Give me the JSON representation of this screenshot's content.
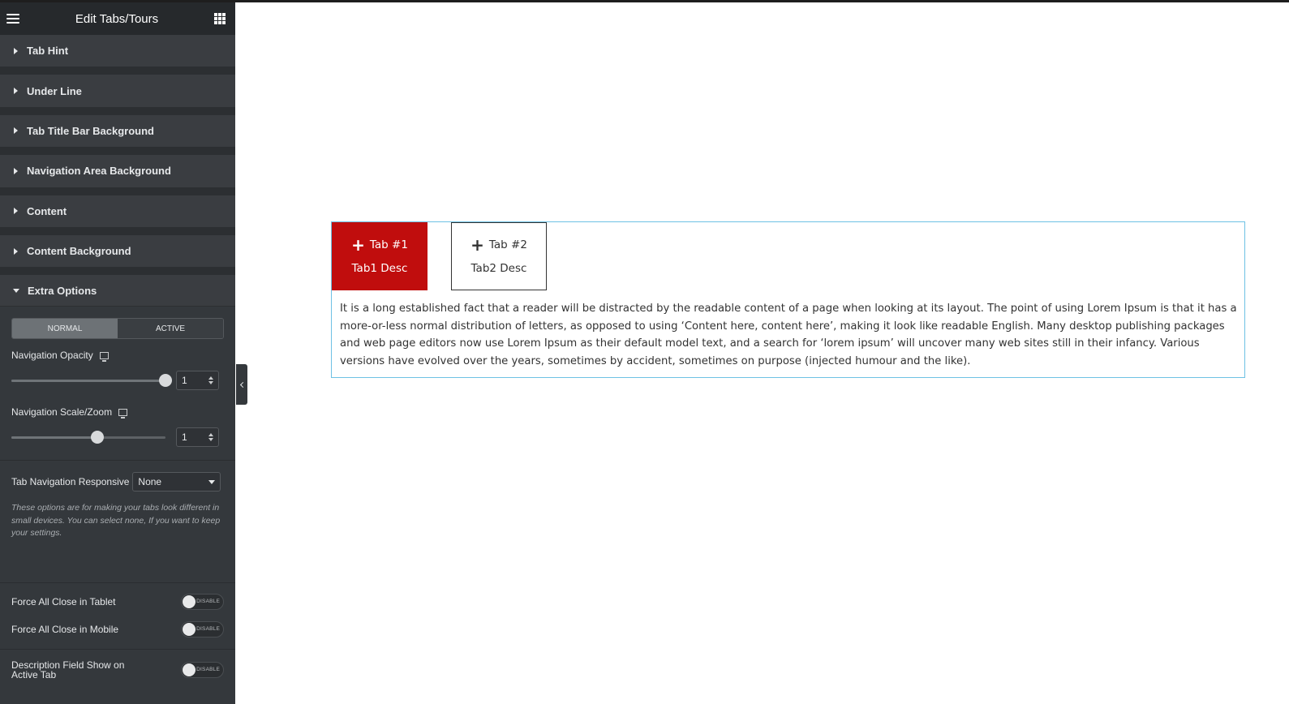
{
  "panel": {
    "title": "Edit Tabs/Tours",
    "sections": [
      {
        "label": "Tab Hint"
      },
      {
        "label": "Under Line"
      },
      {
        "label": "Tab Title Bar Background"
      },
      {
        "label": "Navigation Area Background"
      },
      {
        "label": "Content"
      },
      {
        "label": "Content Background"
      },
      {
        "label": "Extra Options"
      }
    ],
    "extra": {
      "state_tabs": [
        "NORMAL",
        "ACTIVE"
      ],
      "active_state": "NORMAL",
      "opacity_label": "Navigation Opacity",
      "opacity_value": "1",
      "opacity_slider_percent": 100,
      "scale_label": "Navigation Scale/Zoom",
      "scale_value": "1",
      "scale_slider_percent": 56,
      "responsive_label": "Tab Navigation Responsive",
      "responsive_value": "None",
      "responsive_help": "These options are for making your tabs look different in small devices. You can select none, If you want to keep your settings.",
      "toggles": [
        {
          "label": "Force All Close in Tablet",
          "state": "DISABLE"
        },
        {
          "label": "Force All Close in Mobile",
          "state": "DISABLE"
        },
        {
          "label": "Description Field Show on Active Tab",
          "state": "DISABLE"
        }
      ]
    }
  },
  "preview": {
    "tabs": [
      {
        "title": "Tab #1",
        "desc": "Tab1 Desc",
        "active": true
      },
      {
        "title": "Tab #2",
        "desc": "Tab2 Desc",
        "active": false
      }
    ],
    "content": "It is a long established fact that a reader will be distracted by the readable content of a page when looking at its layout. The point of using Lorem Ipsum is that it has a more-or-less normal distribution of letters, as opposed to using ‘Content here, content here’, making it look like readable English. Many desktop publishing packages and web page editors now use Lorem Ipsum as their default model text, and a search for ‘lorem ipsum’ will uncover many web sites still in their infancy. Various versions have evolved over the years, sometimes by accident, sometimes on purpose (injected humour and the like).",
    "colors": {
      "active_tab": "#c00d0d",
      "widget_outline": "#6ec1e4",
      "panel_bg": "#34383c"
    }
  }
}
